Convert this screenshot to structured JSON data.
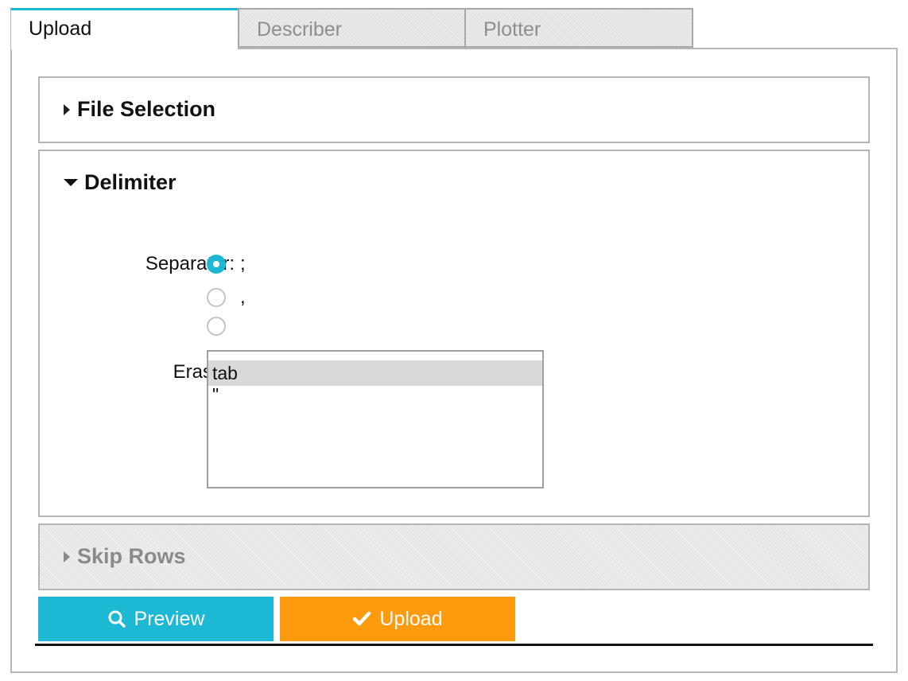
{
  "tabs": [
    {
      "label": "Upload",
      "active": true
    },
    {
      "label": "Describer",
      "active": false
    },
    {
      "label": "Plotter",
      "active": false
    }
  ],
  "sections": {
    "file_selection": {
      "title": "File Selection",
      "expanded": false
    },
    "delimiter": {
      "title": "Delimiter",
      "expanded": true
    },
    "skip_rows": {
      "title": "Skip Rows",
      "expanded": false,
      "disabled": true
    }
  },
  "delimiter": {
    "separator_label": "Separator:",
    "separator_options": [
      {
        "text": ";",
        "checked": true
      },
      {
        "text": ",",
        "checked": false
      },
      {
        "text": "",
        "checked": false
      }
    ],
    "eraser_label": "Eraser:",
    "eraser_options": [
      {
        "text": "tab",
        "selected": true
      },
      {
        "text": "\"",
        "selected": false
      }
    ]
  },
  "buttons": {
    "preview_label": "Preview",
    "preview_icon": "search-icon",
    "upload_label": "Upload",
    "upload_icon": "check-icon"
  },
  "colors": {
    "accent": "#1cb8d4",
    "upload": "#fd9a0d"
  }
}
